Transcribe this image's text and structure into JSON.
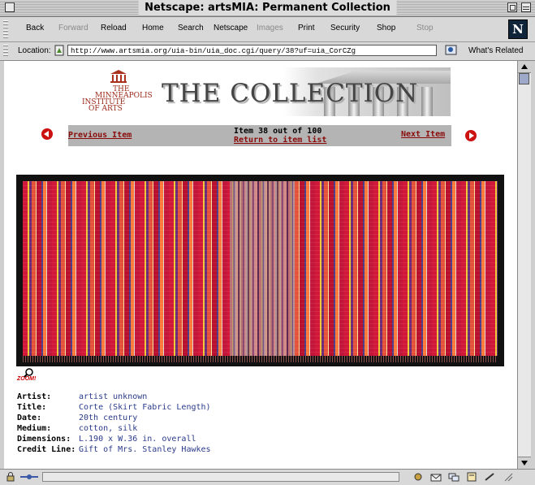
{
  "window": {
    "title": "Netscape: artsMIA: Permanent Collection"
  },
  "toolbar": {
    "back": "Back",
    "forward": "Forward",
    "reload": "Reload",
    "home": "Home",
    "search": "Search",
    "netscape": "Netscape",
    "images": "Images",
    "print": "Print",
    "security": "Security",
    "shop": "Shop",
    "stop": "Stop",
    "logo": "N"
  },
  "location": {
    "label": "Location:",
    "url": "http://www.artsmia.org/uia-bin/uia_doc.cgi/query/38?uf=uia_CorCZg",
    "related": "What's Related"
  },
  "banner": {
    "institute_line1": "THE",
    "institute_line2": "MINNEAPOLIS",
    "institute_line3": "INSTITUTE",
    "institute_line4": "OF ARTS",
    "title": "THE COLLECTION"
  },
  "nav": {
    "previous": "Previous Item",
    "next": "Next Item",
    "count": "Item 38 out of 100",
    "return": "Return to item list"
  },
  "zoom": {
    "label": "ZOOM!"
  },
  "object": {
    "artist_label": "Artist:",
    "artist": "artist unknown",
    "title_label": "Title:",
    "title": "Corte (Skirt Fabric Length)",
    "date_label": "Date:",
    "date": "20th century",
    "medium_label": "Medium:",
    "medium": "cotton, silk",
    "dimensions_label": "Dimensions:",
    "dimensions": "L.190 x W.36 in. overall",
    "credit_label": "Credit Line:",
    "credit": "Gift of Mrs. Stanley Hawkes"
  }
}
